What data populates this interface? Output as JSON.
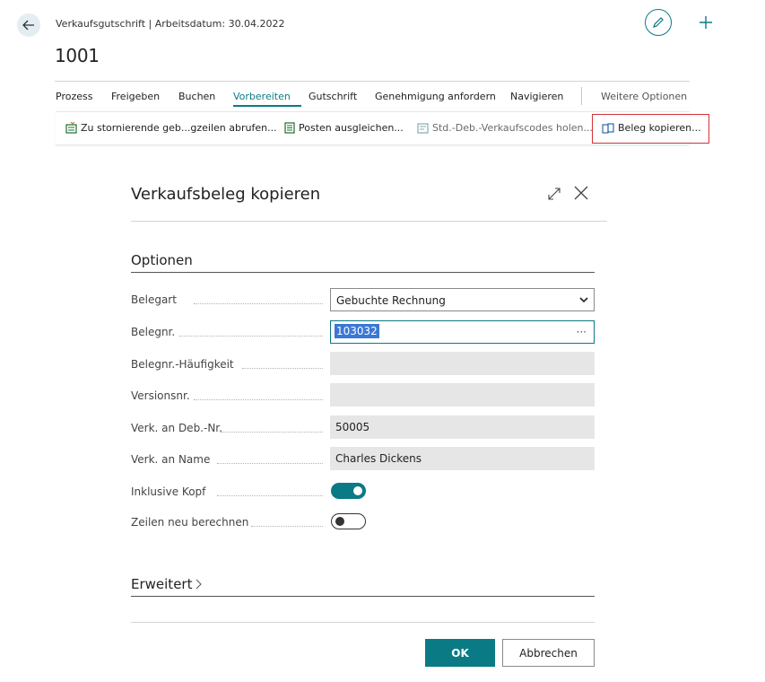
{
  "header": {
    "breadcrumb": "Verkaufsgutschrift | Arbeitsdatum: 30.04.2022",
    "document_number": "1001"
  },
  "menu": {
    "items": [
      "Prozess",
      "Freigeben",
      "Buchen",
      "Vorbereiten",
      "Gutschrift",
      "Genehmigung anfordern",
      "Navigieren",
      "Weitere Optionen"
    ],
    "active": "Vorbereiten"
  },
  "actions": [
    {
      "label": "Zu stornierende geb...gzeilen abrufen...",
      "icon": "get-lines-icon"
    },
    {
      "label": "Posten ausgleichen...",
      "icon": "apply-entries-icon"
    },
    {
      "label": "Std.-Deb.-Verkaufscodes holen...",
      "icon": "sales-codes-icon"
    },
    {
      "label": "Beleg kopieren...",
      "icon": "copy-document-icon",
      "highlighted": true
    }
  ],
  "dialog": {
    "title": "Verkaufsbeleg kopieren",
    "section_title": "Optionen",
    "fields": [
      {
        "label": "Belegart",
        "value": "Gebuchte Rechnung",
        "type": "select"
      },
      {
        "label": "Belegnr.",
        "value": "103032",
        "type": "lookup"
      },
      {
        "label": "Belegnr.-Häufigkeit",
        "value": "",
        "type": "readonly"
      },
      {
        "label": "Versionsnr.",
        "value": "",
        "type": "readonly"
      },
      {
        "label": "Verk. an Deb.-Nr.",
        "value": "50005",
        "type": "readonly"
      },
      {
        "label": "Verk. an Name",
        "value": "Charles Dickens",
        "type": "readonly"
      },
      {
        "label": "Inklusive Kopf",
        "value": true,
        "type": "toggle"
      },
      {
        "label": "Zeilen neu berechnen",
        "value": false,
        "type": "toggle"
      }
    ],
    "advanced_title": "Erweitert",
    "ok_label": "OK",
    "cancel_label": "Abbrechen"
  },
  "colors": {
    "accent": "#0a7b85",
    "highlight_border": "#d13438",
    "selection": "#3a78d4"
  }
}
